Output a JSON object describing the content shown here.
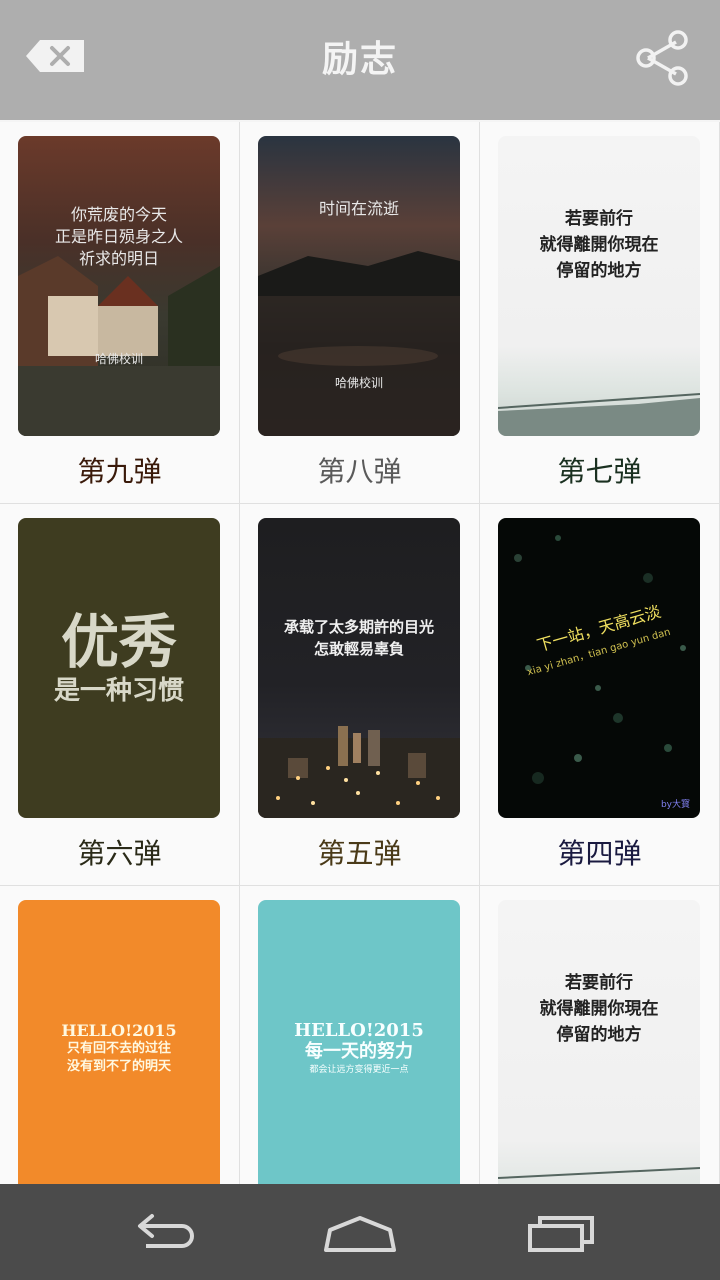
{
  "header": {
    "title": "励志",
    "back_icon": "back-delete-icon",
    "share_icon": "share-icon"
  },
  "grid": {
    "items": [
      {
        "label": "第九弹",
        "label_color": "#3a1a0a",
        "lines": [
          "你荒废的今天",
          "正是昨日殒身之人",
          "祈求的明日"
        ],
        "sub": "哈佛校训"
      },
      {
        "label": "第八弹",
        "label_color": "#5a5a5a",
        "lines": [
          "时间在流逝"
        ],
        "sub": "哈佛校训"
      },
      {
        "label": "第七弹",
        "label_color": "#1a3020",
        "lines": [
          "若要前行",
          "就得離開你現在",
          "停留的地方"
        ]
      },
      {
        "label": "第六弹",
        "label_color": "#2a2a18",
        "lines": [
          "优秀",
          "是一种习惯"
        ]
      },
      {
        "label": "第五弹",
        "label_color": "#4a3a18",
        "lines": [
          "承载了太多期許的目光",
          "怎敢輕易辜負"
        ]
      },
      {
        "label": "第四弹",
        "label_color": "#1a1a40",
        "lines": [
          "下一站，天高云淡",
          "xia yi zhan，tian gao yun dan"
        ],
        "sub": "by大寳"
      },
      {
        "label": "",
        "lines": [
          "HELLO!2015",
          "只有回不去的过往",
          "没有到不了的明天"
        ]
      },
      {
        "label": "",
        "lines": [
          "HELLO!2015",
          "每一天的努力",
          "都会让远方变得更近一点"
        ]
      },
      {
        "label": "",
        "lines": [
          "若要前行",
          "就得離開你現在",
          "停留的地方"
        ]
      }
    ]
  },
  "navbar": {
    "back": "back-arrow-icon",
    "home": "home-icon",
    "recents": "recent-apps-icon"
  }
}
